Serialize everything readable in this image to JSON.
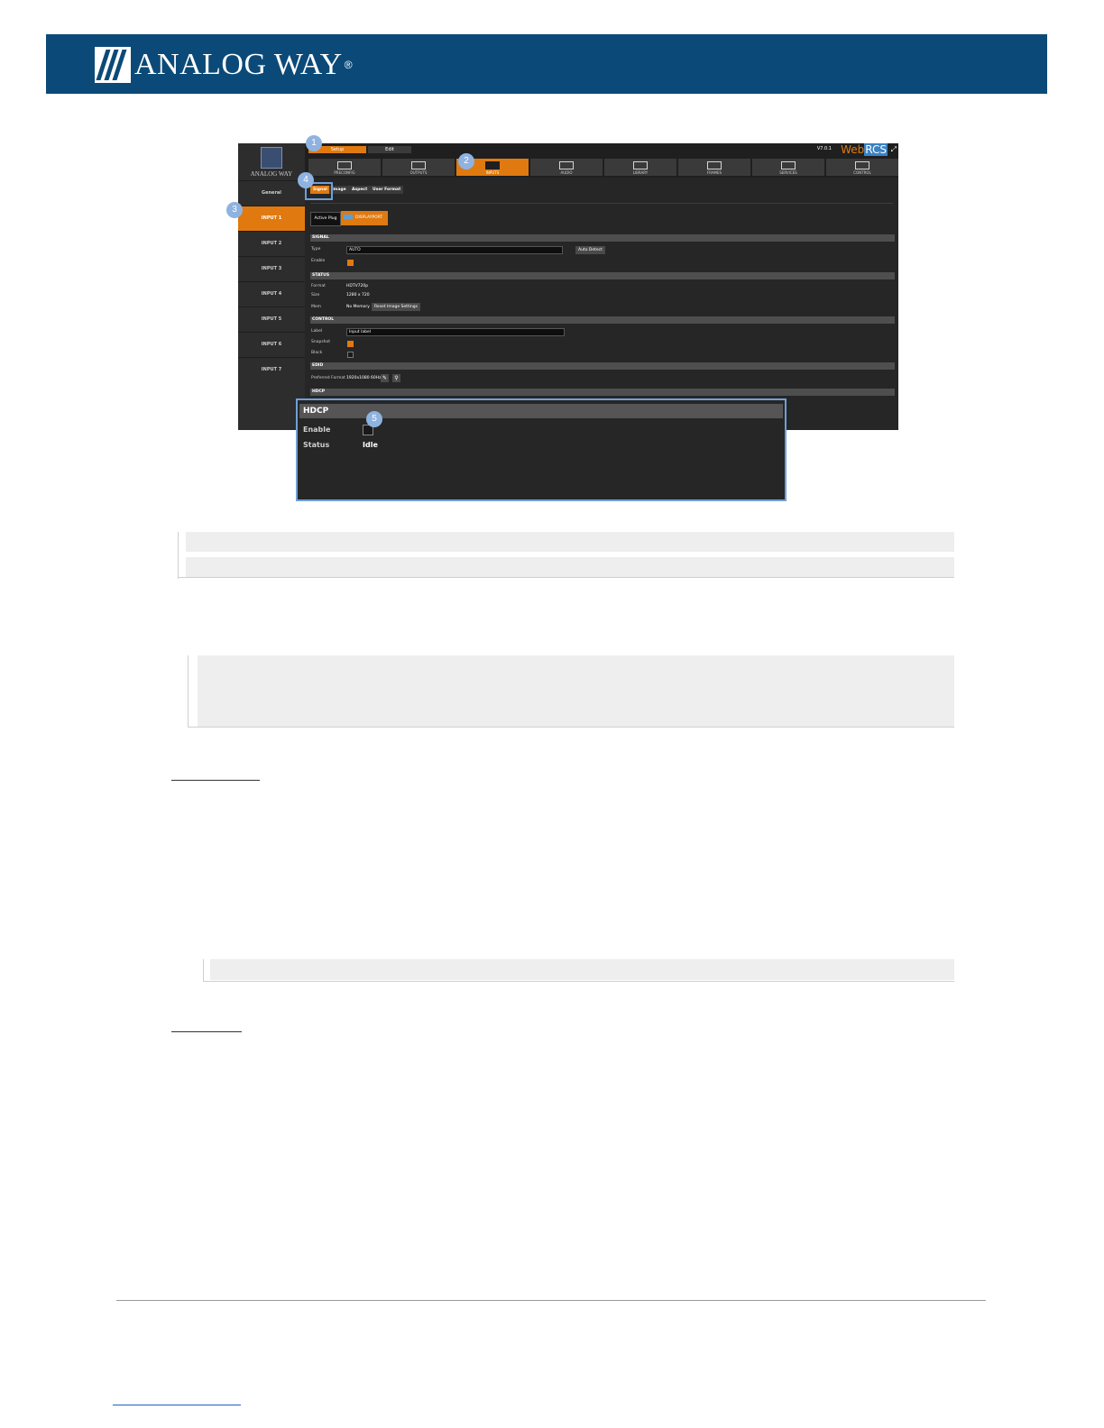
{
  "brand": {
    "name": "ANALOG WAY",
    "reg": "®",
    "bar_color": "#0b4a78"
  },
  "app": {
    "logo_text": "ANALOG WAY",
    "modes": {
      "setup": "Setup",
      "edit": "Edit"
    },
    "version": "V7.0.1",
    "product": {
      "web": "Web",
      "rcs": "RCS"
    },
    "tabs": [
      "PRECONFIG",
      "OUTPUTS",
      "INPUTS",
      "AUDIO",
      "LIBRARY",
      "FRAMES",
      "SERVICES",
      "CONTROL"
    ],
    "sidebar": [
      "General",
      "INPUT 1",
      "INPUT 2",
      "INPUT 3",
      "INPUT 4",
      "INPUT 5",
      "INPUT 6",
      "INPUT 7"
    ],
    "subtabs": [
      "Signal",
      "Image",
      "Aspect",
      "User Format"
    ],
    "active_plug": "Active Plug",
    "displayport": "DISPLAYPORT",
    "signal": {
      "title": "SIGNAL",
      "type_label": "Type",
      "type_value": "AUTO",
      "auto_detect": "Auto Detect",
      "enable_label": "Enable"
    },
    "status": {
      "title": "STATUS",
      "format_label": "Format",
      "format_value": "HDTV720p",
      "size_label": "Size",
      "size_value": "1280 x 720",
      "mem_label": "Mem",
      "mem_value": "No Memory",
      "reset": "Reset Image Settings"
    },
    "control": {
      "title": "CONTROL",
      "label_label": "Label",
      "label_value": "Input label",
      "snapshot_label": "Snapshot",
      "black_label": "Black"
    },
    "edid": {
      "title": "EDID",
      "pref_label": "Preferred Format",
      "pref_value": "1920x1080 60Hz"
    },
    "hdcp_title": "HDCP",
    "accent": "#e07a10"
  },
  "callout": {
    "title": "HDCP",
    "enable_label": "Enable",
    "status_label": "Status",
    "status_value": "Idle",
    "border": "#6fa0d8"
  },
  "badges": [
    "1",
    "2",
    "3",
    "4",
    "5"
  ]
}
